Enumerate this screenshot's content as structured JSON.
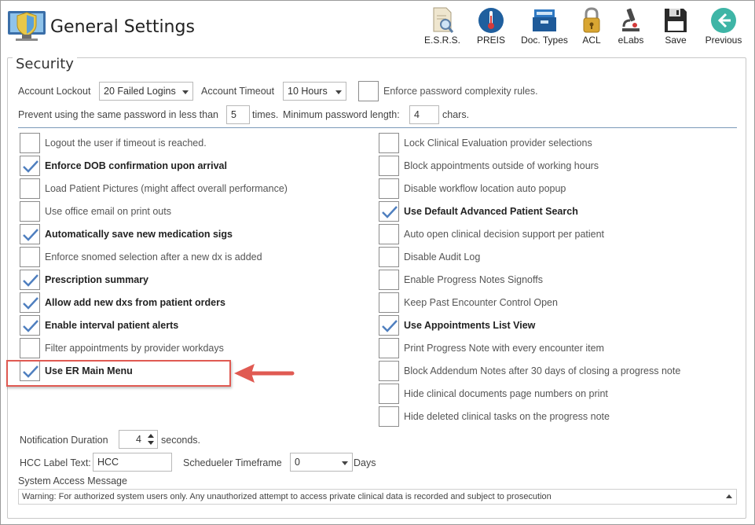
{
  "window": {
    "title": "General Settings"
  },
  "toolbar": [
    {
      "label": "E.S.R.S.",
      "icon": "report-search-icon"
    },
    {
      "label": "PREIS",
      "icon": "thermometer-icon"
    },
    {
      "label": "Doc. Types",
      "icon": "file-box-icon"
    },
    {
      "label": "ACL",
      "icon": "padlock-icon"
    },
    {
      "label": "eLabs",
      "icon": "microscope-icon"
    },
    {
      "label": "Save",
      "icon": "floppy-disk-icon"
    },
    {
      "label": "Previous",
      "icon": "back-arrow-icon"
    }
  ],
  "security": {
    "legend": "Security",
    "account_lockout_label": "Account Lockout",
    "account_lockout_value": "20 Failed Logins",
    "account_timeout_label": "Account Timeout",
    "account_timeout_value": "10 Hours",
    "complexity_label": "Enforce password complexity rules.",
    "complexity_checked": false,
    "prevent_label": "Prevent using the same password in less than",
    "prevent_value": "5",
    "times_label": "times.",
    "min_length_label": "Minimum password length:",
    "min_length_value": "4",
    "chars_label": "chars."
  },
  "left_options": [
    {
      "label": "Logout the user if timeout is reached.",
      "checked": false
    },
    {
      "label": "Enforce DOB confirmation upon arrival",
      "checked": true
    },
    {
      "label": "Load Patient Pictures (might affect overall performance)",
      "checked": false
    },
    {
      "label": "Use office email on print outs",
      "checked": false
    },
    {
      "label": "Automatically save new medication sigs",
      "checked": true
    },
    {
      "label": "Enforce snomed selection after a new dx is added",
      "checked": false
    },
    {
      "label": "Prescription summary",
      "checked": true
    },
    {
      "label": "Allow add new dxs from patient orders",
      "checked": true
    },
    {
      "label": "Enable interval patient alerts",
      "checked": true
    },
    {
      "label": "Filter appointments by provider workdays",
      "checked": false
    },
    {
      "label": "Use ER Main Menu",
      "checked": true
    }
  ],
  "right_options": [
    {
      "label": "Lock Clinical Evaluation provider selections",
      "checked": false
    },
    {
      "label": "Block appointments outside of working hours",
      "checked": false
    },
    {
      "label": "Disable workflow location auto popup",
      "checked": false
    },
    {
      "label": "Use Default Advanced Patient Search",
      "checked": true
    },
    {
      "label": "Auto open clinical decision support per patient",
      "checked": false
    },
    {
      "label": "Disable Audit Log",
      "checked": false
    },
    {
      "label": "Enable Progress Notes Signoffs",
      "checked": false
    },
    {
      "label": "Keep Past Encounter Control Open",
      "checked": false
    },
    {
      "label": "Use Appointments List View",
      "checked": true
    },
    {
      "label": "Print Progress Note with every encounter item",
      "checked": false
    },
    {
      "label": "Block Addendum Notes after 30 days of closing a progress note",
      "checked": false
    },
    {
      "label": "Hide clinical documents page numbers on print",
      "checked": false
    },
    {
      "label": "Hide deleted clinical tasks on the progress note",
      "checked": false
    }
  ],
  "bottom": {
    "notification_label": "Notification Duration",
    "notification_value": "4",
    "seconds_label": "seconds.",
    "hcc_label": "HCC Label Text:",
    "hcc_value": "HCC",
    "scheduler_label": "Schedueler Timeframe",
    "scheduler_value": "0",
    "days_label": "Days",
    "access_message_label": "System Access Message",
    "access_message_value": "Warning: For authorized system users only. Any unauthorized attempt to access private clinical data is recorded and subject to prosecution"
  },
  "colors": {
    "accent_border": "#e05a52",
    "check": "#4f7fbf",
    "separator": "#7a9ab8"
  }
}
